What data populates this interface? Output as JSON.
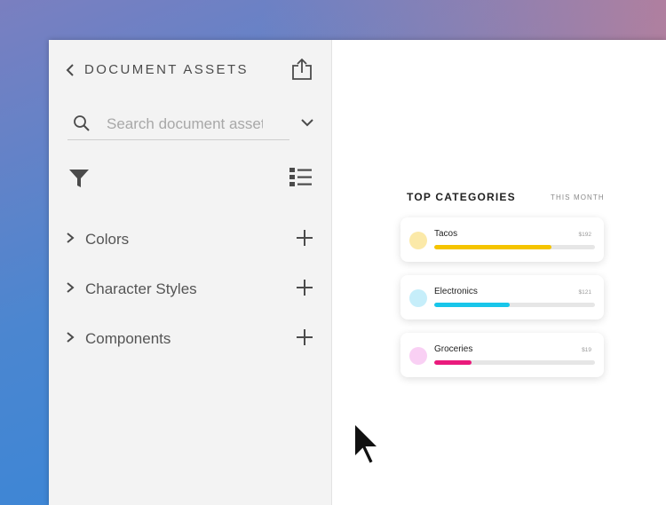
{
  "panel": {
    "title": "DOCUMENT ASSETS",
    "search": {
      "placeholder": "Search document assets",
      "value": ""
    },
    "icons": {
      "back": "chevron-left-icon",
      "share": "share-icon",
      "search": "search-icon",
      "dropdown": "chevron-down-icon",
      "filter": "filter-icon",
      "view": "list-view-icon"
    },
    "sections": [
      {
        "label": "Colors"
      },
      {
        "label": "Character Styles"
      },
      {
        "label": "Components"
      }
    ]
  },
  "canvas": {
    "card": {
      "title": "TOP CATEGORIES",
      "period": "THIS MONTH",
      "categories": [
        {
          "name": "Tacos",
          "amount": "$192",
          "progress": 0.73,
          "color": "#f5c400",
          "dot_color": "#fbe9a8"
        },
        {
          "name": "Electronics",
          "amount": "$121",
          "progress": 0.47,
          "color": "#18c6ea",
          "dot_color": "#c6eefa"
        },
        {
          "name": "Groceries",
          "amount": "$19",
          "progress": 0.23,
          "color": "#ea1a7c",
          "dot_color": "#f9d0f4"
        }
      ]
    }
  },
  "colors": {
    "panel_bg": "#f3f3f3",
    "text": "#555555",
    "accent_warm": "#d67d8c",
    "accent_cool": "#2f86db"
  }
}
